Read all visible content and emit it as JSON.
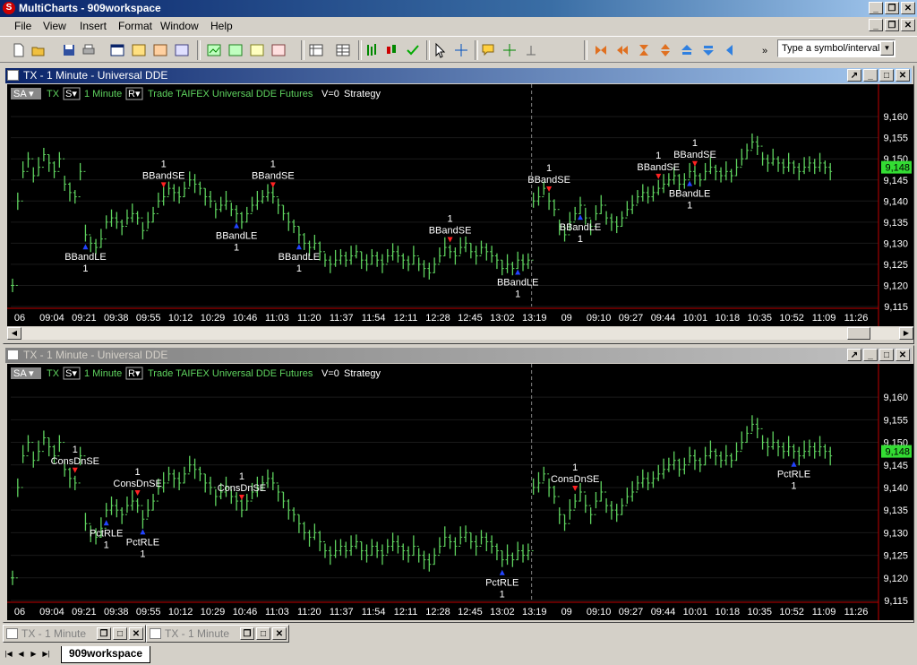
{
  "app": {
    "title": "MultiCharts - 909workspace"
  },
  "menu": [
    "File",
    "View",
    "Insert",
    "Format",
    "Window",
    "Help"
  ],
  "symbol_box": {
    "value": "Type a symbol/interval"
  },
  "windows": [
    {
      "title": "TX - 1 Minute - Universal DDE",
      "status": {
        "sa": "SA",
        "sym": "TX",
        "s": "S",
        "interval": "1 Minute",
        "r": "R",
        "desc": "Trade TAIFEX Universal DDE Futures",
        "v": "V=0",
        "strategy": "Strategy"
      },
      "price_label": "9,148",
      "signals": [
        {
          "name": "BBandLE",
          "qty": "1",
          "dir": "long",
          "bar": 14
        },
        {
          "name": "BBandSE",
          "qty": "1",
          "dir": "short",
          "bar": 29
        },
        {
          "name": "BBandLE",
          "qty": "1",
          "dir": "long",
          "bar": 43
        },
        {
          "name": "BBandSE",
          "qty": "1",
          "dir": "short",
          "bar": 50
        },
        {
          "name": "BBandLE",
          "qty": "1",
          "dir": "long",
          "bar": 55
        },
        {
          "name": "BBandSE",
          "qty": "1",
          "dir": "short",
          "bar": 84
        },
        {
          "name": "BBandLE",
          "qty": "1",
          "dir": "long",
          "bar": 97
        },
        {
          "name": "BBandSE",
          "qty": "1",
          "dir": "short",
          "bar": 103
        },
        {
          "name": "BBandLE",
          "qty": "1",
          "dir": "long",
          "bar": 109
        },
        {
          "name": "BBandSE",
          "qty": "1",
          "dir": "short",
          "bar": 124
        },
        {
          "name": "BBandSE",
          "qty": "1",
          "dir": "short",
          "bar": 131
        },
        {
          "name": "BBandLE",
          "qty": "1",
          "dir": "long",
          "bar": 130
        }
      ]
    },
    {
      "title": "TX - 1 Minute - Universal DDE",
      "status": {
        "sa": "SA",
        "sym": "TX",
        "s": "S",
        "interval": "1 Minute",
        "r": "R",
        "desc": "Trade TAIFEX Universal DDE Futures",
        "v": "V=0",
        "strategy": "Strategy"
      },
      "price_label": "9,148",
      "signals": [
        {
          "name": "ConsDnSE",
          "qty": "1",
          "dir": "short",
          "bar": 12
        },
        {
          "name": "PctRLE",
          "qty": "1",
          "dir": "long",
          "bar": 18
        },
        {
          "name": "ConsDnSE",
          "qty": "1",
          "dir": "short",
          "bar": 24
        },
        {
          "name": "PctRLE",
          "qty": "1",
          "dir": "long",
          "bar": 25
        },
        {
          "name": "ConsDnSE",
          "qty": "1",
          "dir": "short",
          "bar": 44
        },
        {
          "name": "PctRLE",
          "qty": "1",
          "dir": "long",
          "bar": 94
        },
        {
          "name": "ConsDnSE",
          "qty": "1",
          "dir": "short",
          "bar": 108
        },
        {
          "name": "PctRLE",
          "qty": "1",
          "dir": "long",
          "bar": 150
        }
      ]
    }
  ],
  "chart_data": {
    "type": "bar",
    "title": "",
    "series": [
      {
        "values": [
          9120,
          9140,
          9147,
          9150,
          9146,
          9148,
          9151,
          9149,
          9147,
          9150,
          9144,
          9142,
          9141,
          9147,
          9132,
          9130,
          9129,
          9131,
          9135,
          9136,
          9135,
          9134,
          9136,
          9137,
          9136,
          9133,
          9135,
          9137,
          9140,
          9141,
          9143,
          9142,
          9141,
          9143,
          9145,
          9144,
          9143,
          9141,
          9140,
          9138,
          9139,
          9140,
          9138,
          9137,
          9135,
          9137,
          9139,
          9140,
          9141,
          9142,
          9141,
          9139,
          9137,
          9135,
          9134,
          9132,
          9130,
          9129,
          9130,
          9128,
          9126,
          9125,
          9126,
          9127,
          9126,
          9127,
          9128,
          9126,
          9125,
          9127,
          9126,
          9125,
          9127,
          9128,
          9127,
          9126,
          9125,
          9127,
          9125,
          9124,
          9123,
          9125,
          9127,
          9129,
          9128,
          9127,
          9129,
          9130,
          9128,
          9127,
          9129,
          9128,
          9127,
          9126,
          9124,
          9125,
          9124,
          9126,
          9125,
          9126,
          9140,
          9141,
          9143,
          9140,
          9138,
          9134,
          9132,
          9135,
          9137,
          9139,
          9136,
          9134,
          9137,
          9139,
          9136,
          9135,
          9134,
          9136,
          9138,
          9139,
          9141,
          9142,
          9141,
          9142,
          9143,
          9144,
          9145,
          9146,
          9144,
          9145,
          9147,
          9146,
          9145,
          9147,
          9148,
          9147,
          9146,
          9147,
          9146,
          9148,
          9150,
          9152,
          9154,
          9153,
          9150,
          9149,
          9150,
          9149,
          9148,
          9149,
          9148,
          9147,
          9148,
          9149,
          9148,
          9149,
          9148,
          9147
        ]
      }
    ],
    "x_tick_labels": [
      "06",
      "09:04",
      "09:21",
      "09:38",
      "09:55",
      "10:12",
      "10:29",
      "10:46",
      "11:03",
      "11:20",
      "11:37",
      "11:54",
      "12:11",
      "12:28",
      "12:45",
      "13:02",
      "13:19",
      "09",
      "09:10",
      "09:27",
      "09:44",
      "10:01",
      "10:18",
      "10:35",
      "10:52",
      "11:09",
      "11:26"
    ],
    "y_tick_labels": [
      "9,160",
      "9,155",
      "9,150",
      "9,145",
      "9,140",
      "9,135",
      "9,130",
      "9,125",
      "9,120",
      "9,115"
    ],
    "ylim": [
      9115,
      9163
    ],
    "last_price": 9148,
    "grid": true
  },
  "minimized": [
    {
      "title": "TX - 1 Minute"
    },
    {
      "title": "TX - 1 Minute"
    }
  ],
  "workspace_tab": "909workspace",
  "colors": {
    "bar": "#5fd35f",
    "long_marker": "#2244ff",
    "short_marker": "#ff2222",
    "price_box": "#33dd33",
    "session_line": "#c00000"
  }
}
